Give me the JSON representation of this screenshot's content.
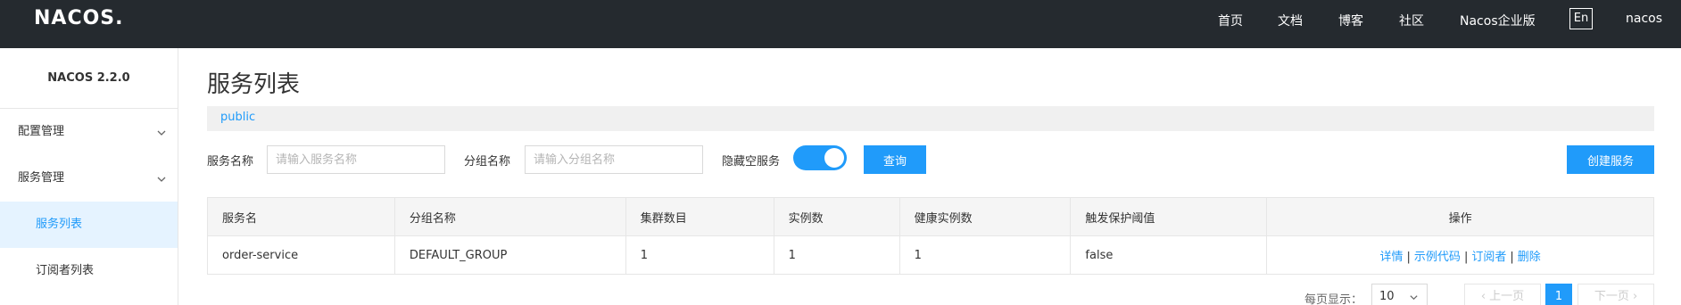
{
  "topbar": {
    "logo": "NACOS.",
    "nav": [
      "首页",
      "文档",
      "博客",
      "社区",
      "Nacos企业版"
    ],
    "lang": "En",
    "user": "nacos"
  },
  "sidebar": {
    "version": "NACOS 2.2.0",
    "groups": [
      {
        "label": "配置管理",
        "icon": "chevron-down-icon"
      },
      {
        "label": "服务管理",
        "icon": "chevron-down-icon"
      }
    ],
    "items": [
      {
        "label": "服务列表",
        "active": true
      },
      {
        "label": "订阅者列表",
        "active": false
      }
    ]
  },
  "main": {
    "title": "服务列表",
    "namespace": "public",
    "filters": {
      "service_name_label": "服务名称",
      "service_name_placeholder": "请输入服务名称",
      "group_name_label": "分组名称",
      "group_name_placeholder": "请输入分组名称",
      "hide_empty_label": "隐藏空服务",
      "hide_empty_on": true,
      "query_button": "查询",
      "create_button": "创建服务"
    },
    "table": {
      "headers": [
        "服务名",
        "分组名称",
        "集群数目",
        "实例数",
        "健康实例数",
        "触发保护阈值",
        "操作"
      ],
      "rows": [
        {
          "service": "order-service",
          "group": "DEFAULT_GROUP",
          "clusters": "1",
          "instances": "1",
          "healthy": "1",
          "threshold": "false",
          "ops": [
            "详情",
            "示例代码",
            "订阅者",
            "删除"
          ]
        }
      ]
    },
    "pagination": {
      "page_size_label": "每页显示：",
      "page_size": "10",
      "prev": "上一页",
      "current": "1",
      "next": "下一页"
    }
  },
  "colors": {
    "accent": "#209bfa",
    "topbar": "#252a2f",
    "active_bg": "#e5f3ff"
  }
}
